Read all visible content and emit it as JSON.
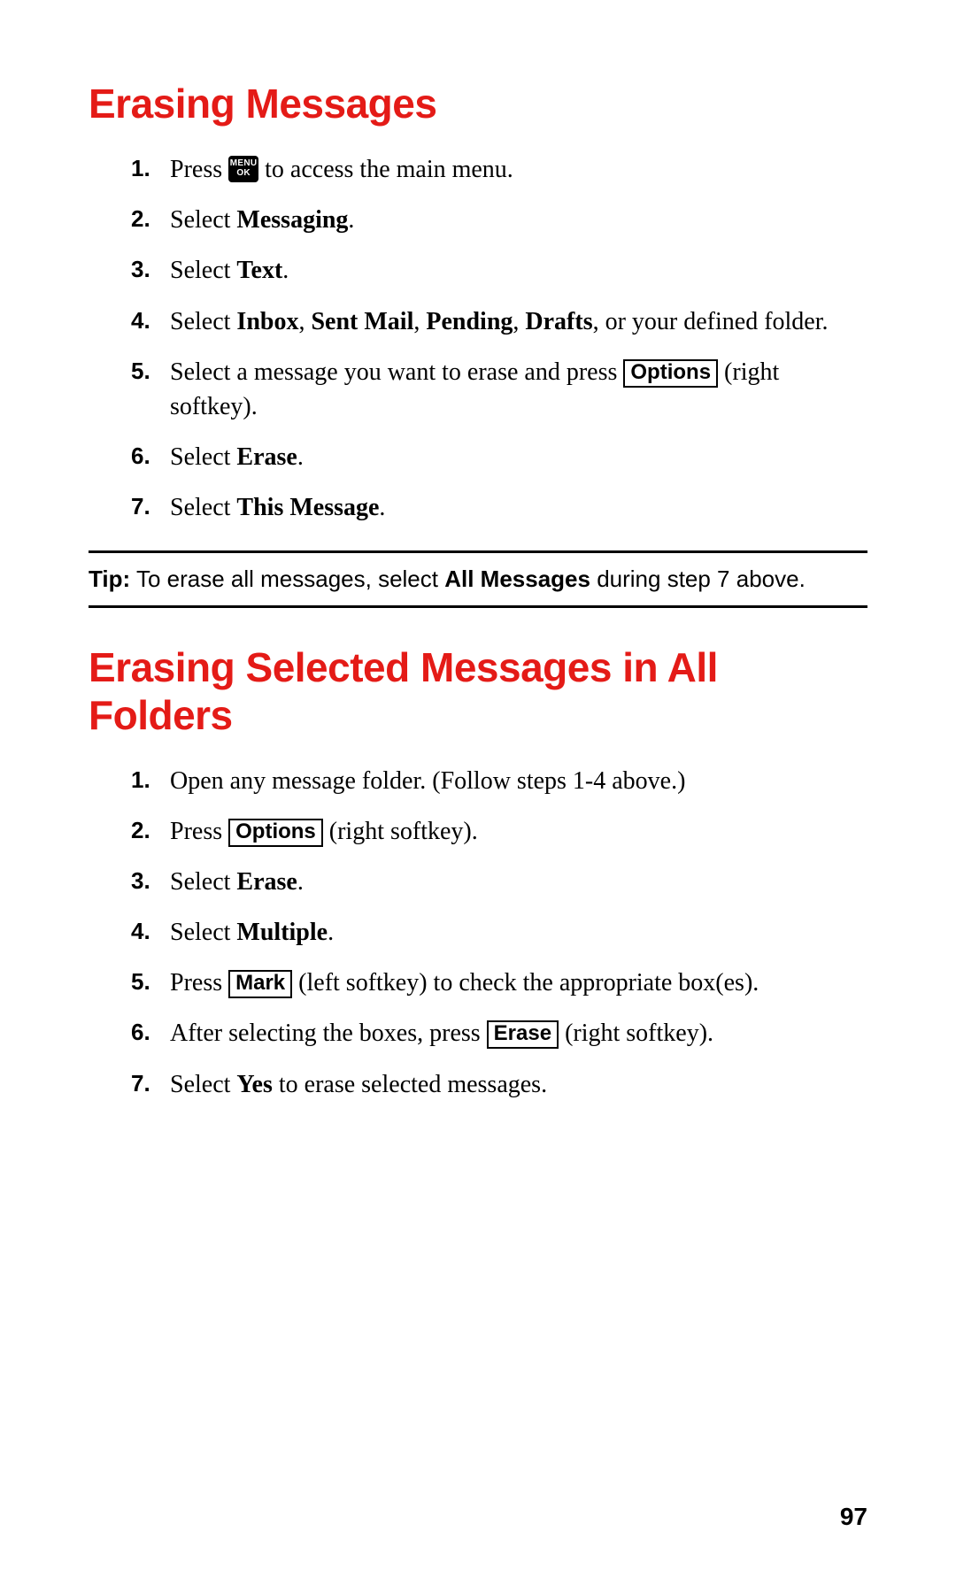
{
  "section1": {
    "title": "Erasing Messages",
    "steps": {
      "s1": {
        "num": "1.",
        "t1": "Press ",
        "menu_top": "MENU",
        "menu_bottom": "OK",
        "t2": " to access the main menu."
      },
      "s2": {
        "num": "2.",
        "t1": "Select ",
        "b1": "Messaging",
        "t2": "."
      },
      "s3": {
        "num": "3.",
        "t1": "Select ",
        "b1": "Text",
        "t2": "."
      },
      "s4": {
        "num": "4.",
        "t1": "Select ",
        "b1": "Inbox",
        "c1": ", ",
        "b2": "Sent Mail",
        "c2": ", ",
        "b3": "Pending",
        "c3": ", ",
        "b4": "Drafts",
        "t2": ", or your defined folder."
      },
      "s5": {
        "num": "5.",
        "t1": "Select a message you want to erase and press ",
        "sk": "Options",
        "t2": " (right softkey)."
      },
      "s6": {
        "num": "6.",
        "t1": "Select ",
        "b1": "Erase",
        "t2": "."
      },
      "s7": {
        "num": "7.",
        "t1": "Select ",
        "b1": "This Message",
        "t2": "."
      }
    }
  },
  "tip": {
    "label": "Tip:",
    "t1": " To erase all messages, select ",
    "b1": "All Messages",
    "t2": " during step 7 above."
  },
  "section2": {
    "title": "Erasing Selected Messages in All Folders",
    "steps": {
      "s1": {
        "num": "1.",
        "t1": "Open any message folder. (Follow steps 1-4 above.)"
      },
      "s2": {
        "num": "2.",
        "t1": "Press ",
        "sk": "Options",
        "t2": " (right softkey)."
      },
      "s3": {
        "num": "3.",
        "t1": "Select ",
        "b1": "Erase",
        "t2": "."
      },
      "s4": {
        "num": "4.",
        "t1": "Select ",
        "b1": "Multiple",
        "t2": "."
      },
      "s5": {
        "num": "5.",
        "t1": "Press ",
        "sk": "Mark",
        "t2": " (left softkey) to check the appropriate box(es)."
      },
      "s6": {
        "num": "6.",
        "t1": "After selecting the boxes, press ",
        "sk": "Erase",
        "t2": " (right softkey)."
      },
      "s7": {
        "num": "7.",
        "t1": "Select ",
        "b1": "Yes",
        "t2": " to erase selected messages."
      }
    }
  },
  "page_number": "97"
}
